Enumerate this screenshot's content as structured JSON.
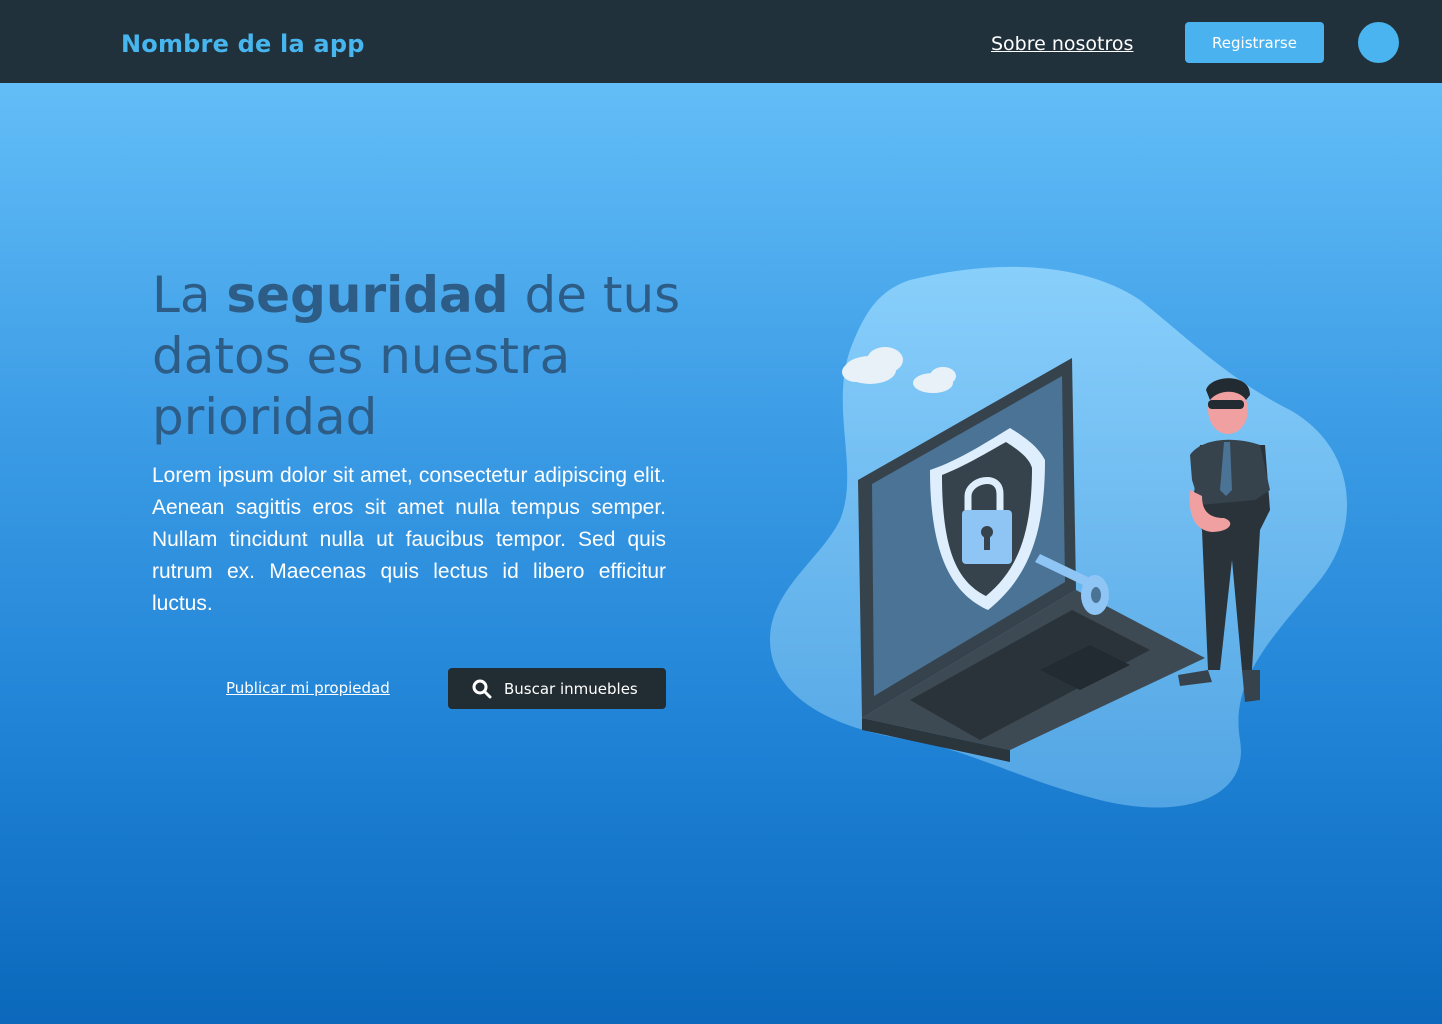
{
  "header": {
    "brand": "Nombre de la app",
    "nav_link": "Sobre nosotros",
    "register_label": "Registrarse"
  },
  "hero": {
    "headline_pre": "La ",
    "headline_bold": "seguridad",
    "headline_post": " de tus datos es nuestra prioridad",
    "body": "Lorem ipsum dolor sit amet, consectetur adipiscing elit. Aenean sagittis eros sit amet nulla tempus semper. Nullam tincidunt nulla ut faucibus tempor. Sed quis rutrum ex. Maecenas quis lectus id libero efficitur luctus.",
    "publish_link": "Publicar mi propiedad",
    "search_button": "Buscar inmuebles"
  },
  "icons": {
    "search": "search-icon",
    "avatar": "user-avatar"
  },
  "colors": {
    "navbar_bg": "#21313b",
    "brand": "#47b6ef",
    "accent": "#4ab2ee",
    "headline": "#2d5d87",
    "dark_button": "#222c33"
  }
}
